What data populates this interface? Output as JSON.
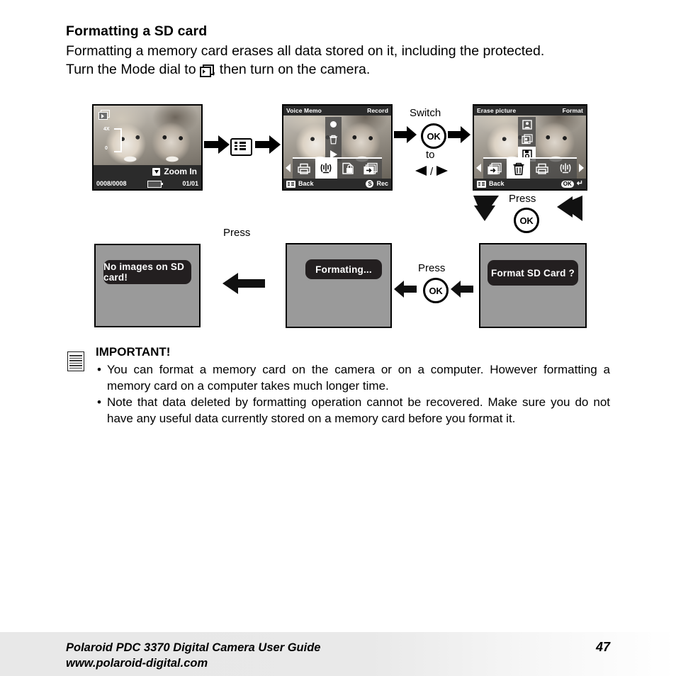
{
  "heading": "Formatting a SD card",
  "intro_paragraph": "Formatting a memory card erases all data stored on it, including the protected.",
  "mode_dial_line_before": "Turn the Mode dial to ",
  "mode_dial_line_after": ", then turn on the camera.",
  "screens": {
    "playback": {
      "zoom_scale_top": "4X",
      "zoom_scale_bottom": "0",
      "zoom_label": "Zoom In",
      "counter": "0008/0008",
      "page_counter": "01/01"
    },
    "voice_memo": {
      "title": "Voice Memo",
      "title_right": "Record",
      "back_label": "Back",
      "rec_label": "Rec",
      "rec_badge": "S",
      "icons": [
        "print-icon",
        "voice-memo-icon",
        "protect-icon",
        "copy-icon"
      ],
      "selected_icon": "voice-memo-icon",
      "submenu_icons": [
        "record-dot-icon",
        "trash-icon",
        "play-icon"
      ]
    },
    "erase_picture": {
      "title": "Erase picture",
      "title_right": "Format",
      "back_label": "Back",
      "ok_badge": "OK",
      "icons": [
        "copy-icon",
        "trash-icon",
        "print-icon",
        "voice-memo-icon"
      ],
      "selected_icon": "trash-icon",
      "submenu_icons": [
        "single-image-icon",
        "all-images-icon",
        "format-card-icon"
      ],
      "selected_submenu_icon": "format-card-icon"
    },
    "format_prompt": {
      "message": "Format SD Card ?"
    },
    "formatting": {
      "message": "Formating..."
    },
    "no_images": {
      "message": "No images on SD card!"
    }
  },
  "connectors": {
    "press_menu_label": "Press",
    "switch_label": "Switch",
    "to_label": "to",
    "left_right_label": "/",
    "press_ok_top_label": "Press",
    "press_ok_bottom_label": "Press",
    "ok_text": "OK"
  },
  "note": {
    "title": "IMPORTANT!",
    "bullets": [
      "You can format a memory card on the camera or on a computer. However formatting a memory card on a computer takes much longer time.",
      "Note that data deleted by formatting operation cannot be recovered. Make sure you do not have any useful data currently stored on a memory card before you format it."
    ]
  },
  "footer": {
    "line1": "Polaroid PDC 3370 Digital Camera User Guide",
    "line2": "www.polaroid-digital.com",
    "page_number": "47"
  },
  "colors": {
    "lcd_background": "#9a9a9a",
    "lcd_bar": "#2b2b2b",
    "pill": "#231f20",
    "footer_band": "#e8e8e8"
  }
}
